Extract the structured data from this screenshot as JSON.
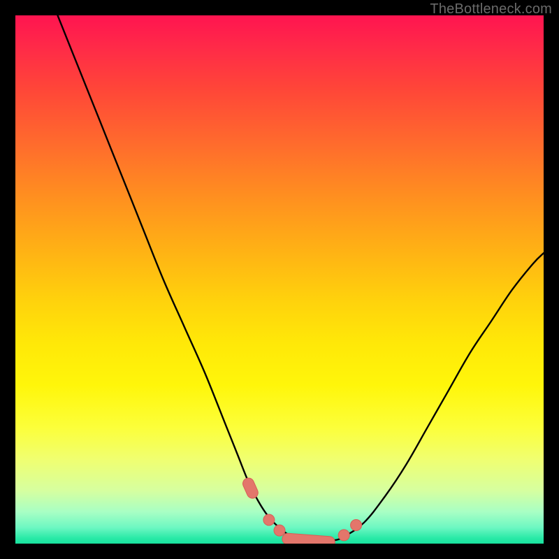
{
  "watermark": {
    "text": "TheBottleneck.com"
  },
  "colors": {
    "frame": "#000000",
    "curve_stroke": "#000000",
    "marker_fill": "#e3766b",
    "marker_stroke": "#d85e56",
    "gradient_top": "#ff1450",
    "gradient_bottom": "#18e29e"
  },
  "chart_data": {
    "type": "line",
    "title": "",
    "xlabel": "",
    "ylabel": "",
    "xlim": [
      0,
      100
    ],
    "ylim": [
      0,
      100
    ],
    "grid": false,
    "legend": false,
    "series": [
      {
        "name": "bottleneck-curve",
        "x": [
          8,
          12,
          16,
          20,
          24,
          28,
          32,
          36,
          40,
          42,
          44,
          46,
          48,
          50,
          52,
          54,
          56,
          58,
          60,
          62,
          66,
          70,
          74,
          78,
          82,
          86,
          90,
          94,
          98,
          100
        ],
        "values": [
          100,
          90,
          80,
          70,
          60,
          50,
          41,
          32,
          22,
          17,
          12,
          8,
          5,
          3,
          1.5,
          0.8,
          0.5,
          0.5,
          0.6,
          1.2,
          4,
          9,
          15,
          22,
          29,
          36,
          42,
          48,
          53,
          55
        ]
      }
    ],
    "markers": [
      {
        "x": 44.5,
        "y": 10.5,
        "shape": "pill",
        "len": 4
      },
      {
        "x": 48.0,
        "y": 4.5,
        "shape": "dot"
      },
      {
        "x": 50.0,
        "y": 2.5,
        "shape": "dot"
      },
      {
        "x": 55.5,
        "y": 0.6,
        "shape": "pill",
        "len": 10
      },
      {
        "x": 62.2,
        "y": 1.6,
        "shape": "dot"
      },
      {
        "x": 64.5,
        "y": 3.5,
        "shape": "dot"
      }
    ]
  }
}
